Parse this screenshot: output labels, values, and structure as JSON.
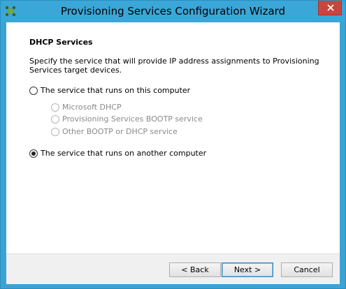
{
  "window": {
    "title": "Provisioning Services Configuration Wizard",
    "close_glyph": "✕",
    "accent_color": "#3ba6d8"
  },
  "page": {
    "section_title": "DHCP Services",
    "description": "Specify the service that will provide IP address assignments to Provisioning Services target devices."
  },
  "options": {
    "this_computer": {
      "label": "The service that runs on this computer",
      "checked": false
    },
    "sub_options": [
      {
        "label": "Microsoft DHCP",
        "enabled": false
      },
      {
        "label": "Provisioning Services BOOTP service",
        "enabled": false
      },
      {
        "label": "Other BOOTP or DHCP service",
        "enabled": false
      }
    ],
    "another_computer": {
      "label": "The service that runs on another computer",
      "checked": true
    }
  },
  "buttons": {
    "back": "< Back",
    "next": "Next >",
    "cancel": "Cancel"
  },
  "icons": {
    "app": "citrix-icon",
    "close": "close-icon"
  }
}
